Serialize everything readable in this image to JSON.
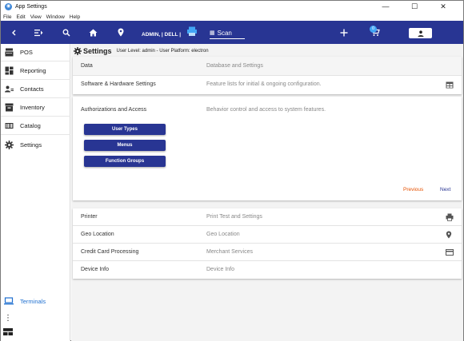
{
  "window": {
    "title": "App Settings",
    "minimize": "—",
    "maximize": "☐",
    "close": "✕"
  },
  "menubar": [
    "File",
    "Edit",
    "View",
    "Window",
    "Help"
  ],
  "appbar": {
    "user_label": "ADMIN, | DELL |",
    "scan_placeholder": "Scan",
    "cart_count": "0"
  },
  "sidebar": {
    "items": [
      {
        "label": "POS",
        "icon": "pos-icon"
      },
      {
        "label": "Reporting",
        "icon": "dashboard-icon"
      },
      {
        "label": "Contacts",
        "icon": "contacts-icon"
      },
      {
        "label": "Inventory",
        "icon": "inventory-icon"
      },
      {
        "label": "Catalog",
        "icon": "catalog-icon"
      },
      {
        "label": "Settings",
        "icon": "gear-icon"
      }
    ],
    "terminals": "Terminals",
    "more": "⋮"
  },
  "settings": {
    "title": "Settings",
    "info": "User Level: admin - User Platform: electron",
    "header": {
      "col1": "Data",
      "col2": "Database and Settings"
    },
    "software": {
      "label": "Software & Hardware Settings",
      "desc": "Feature lists for initial & ongoing configuration."
    },
    "auth": {
      "label": "Authorizations and Access",
      "desc": "Behavior control and access to system features."
    },
    "buttons": {
      "user_types": "User Types",
      "menus": "Menus",
      "function_groups": "Function Groups"
    },
    "pager": {
      "previous": "Previous",
      "next": "Next"
    },
    "rows": [
      {
        "label": "Printer",
        "desc": "Print Test and Settings",
        "icon": "printer-icon"
      },
      {
        "label": "Geo Location",
        "desc": "Geo Location",
        "icon": "location-pin-icon"
      },
      {
        "label": "Credit Card Processing",
        "desc": "Merchant Services",
        "icon": "credit-card-icon"
      },
      {
        "label": "Device Info",
        "desc": "Device Info",
        "icon": ""
      }
    ]
  },
  "colors": {
    "appbar": "#283593",
    "previous": "#e65100",
    "next": "#283593",
    "terminals": "#1e6fd0"
  }
}
